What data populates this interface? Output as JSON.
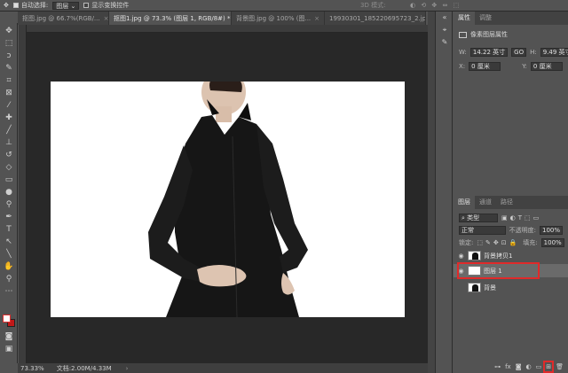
{
  "option_bar": {
    "auto_select_label": "自动选择:",
    "auto_select_target": "图层",
    "show_transform_label": "显示变换控件",
    "mode_3d_label": "3D 模式:"
  },
  "tabs": [
    {
      "label": "抠图.jpg @ 66.7%(RGB/..."
    },
    {
      "label": "抠图1.jpg @ 73.3% (图层 1, RGB/8#) *"
    },
    {
      "label": "背景图.jpg @ 100% (图..."
    },
    {
      "label": "19930301_185220695723_2.jpg"
    }
  ],
  "status": {
    "zoom": "73.33%",
    "doc_size": "文档:2.00M/4.33M"
  },
  "properties": {
    "tab_properties": "属性",
    "tab_adjustments": "调整",
    "section_title": "像素图层属性",
    "w_label": "W:",
    "w_value": "14.22 英寸",
    "link_label": "GO",
    "h_label": "H:",
    "h_value": "9.49 英寸",
    "x_label": "X:",
    "x_value": "0 厘米",
    "y_label": "Y:",
    "y_value": "0 厘米"
  },
  "layers": {
    "tab_layers": "图层",
    "tab_channels": "通道",
    "tab_paths": "路径",
    "filter_kind": "类型",
    "blend_mode": "正常",
    "opacity_label": "不透明度:",
    "opacity_value": "100%",
    "lock_label": "锁定:",
    "fill_label": "填充:",
    "fill_value": "100%",
    "items": [
      {
        "name": "背景拷贝1"
      },
      {
        "name": "图层 1"
      },
      {
        "name": "背景"
      }
    ]
  },
  "colors": {
    "accent_highlight": "#e02a2a",
    "foreground_swatch": "#ffffff",
    "background_swatch": "#c01818"
  }
}
